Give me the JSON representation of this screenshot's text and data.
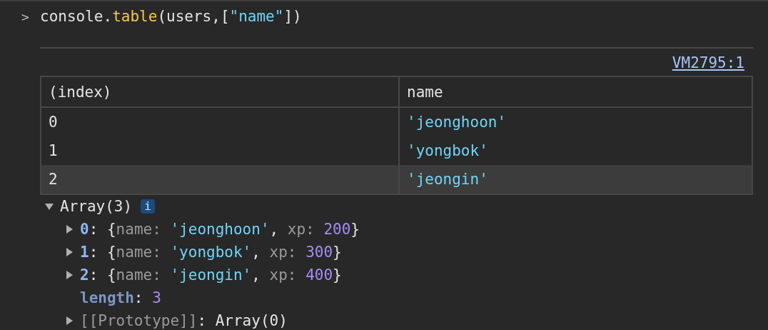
{
  "command": {
    "prompt": ">",
    "tokens": [
      {
        "kind": "plain",
        "text": "console."
      },
      {
        "kind": "method",
        "text": "table"
      },
      {
        "kind": "plain",
        "text": "(users,["
      },
      {
        "kind": "string",
        "text": "\"name\""
      },
      {
        "kind": "plain",
        "text": "])"
      }
    ]
  },
  "source_link": "VM2795:1",
  "table": {
    "columns": [
      "(index)",
      "name"
    ],
    "rows": [
      {
        "cells": [
          "0",
          "'jeonghoon'"
        ],
        "highlighted": false
      },
      {
        "cells": [
          "1",
          "'yongbok'"
        ],
        "highlighted": false
      },
      {
        "cells": [
          "2",
          "'jeongin'"
        ],
        "highlighted": true
      }
    ]
  },
  "tree": {
    "label": "Array(3)",
    "expanded": true,
    "badge": "i",
    "children": [
      {
        "key": "0",
        "kind": "index",
        "expanded": false,
        "tokens": [
          {
            "kind": "punct",
            "text": ": {"
          },
          {
            "kind": "prop",
            "text": "name: "
          },
          {
            "kind": "string",
            "text": "'jeonghoon'"
          },
          {
            "kind": "punct",
            "text": ", "
          },
          {
            "kind": "prop",
            "text": "xp: "
          },
          {
            "kind": "number",
            "text": "200"
          },
          {
            "kind": "punct",
            "text": "}"
          }
        ]
      },
      {
        "key": "1",
        "kind": "index",
        "expanded": false,
        "tokens": [
          {
            "kind": "punct",
            "text": ": {"
          },
          {
            "kind": "prop",
            "text": "name: "
          },
          {
            "kind": "string",
            "text": "'yongbok'"
          },
          {
            "kind": "punct",
            "text": ", "
          },
          {
            "kind": "prop",
            "text": "xp: "
          },
          {
            "kind": "number",
            "text": "300"
          },
          {
            "kind": "punct",
            "text": "}"
          }
        ]
      },
      {
        "key": "2",
        "kind": "index",
        "expanded": false,
        "tokens": [
          {
            "kind": "punct",
            "text": ": {"
          },
          {
            "kind": "prop",
            "text": "name: "
          },
          {
            "kind": "string",
            "text": "'jeongin'"
          },
          {
            "kind": "punct",
            "text": ", "
          },
          {
            "kind": "prop",
            "text": "xp: "
          },
          {
            "kind": "number",
            "text": "400"
          },
          {
            "kind": "punct",
            "text": "}"
          }
        ]
      },
      {
        "key": "length",
        "kind": "internal",
        "tokens": [
          {
            "kind": "punct",
            "text": ": "
          },
          {
            "kind": "number",
            "text": "3"
          }
        ]
      },
      {
        "key": "[[Prototype]]",
        "kind": "hidden",
        "expanded": false,
        "tokens": [
          {
            "kind": "punct",
            "text": ": "
          },
          {
            "kind": "plain",
            "text": "Array(0)"
          }
        ]
      }
    ]
  }
}
